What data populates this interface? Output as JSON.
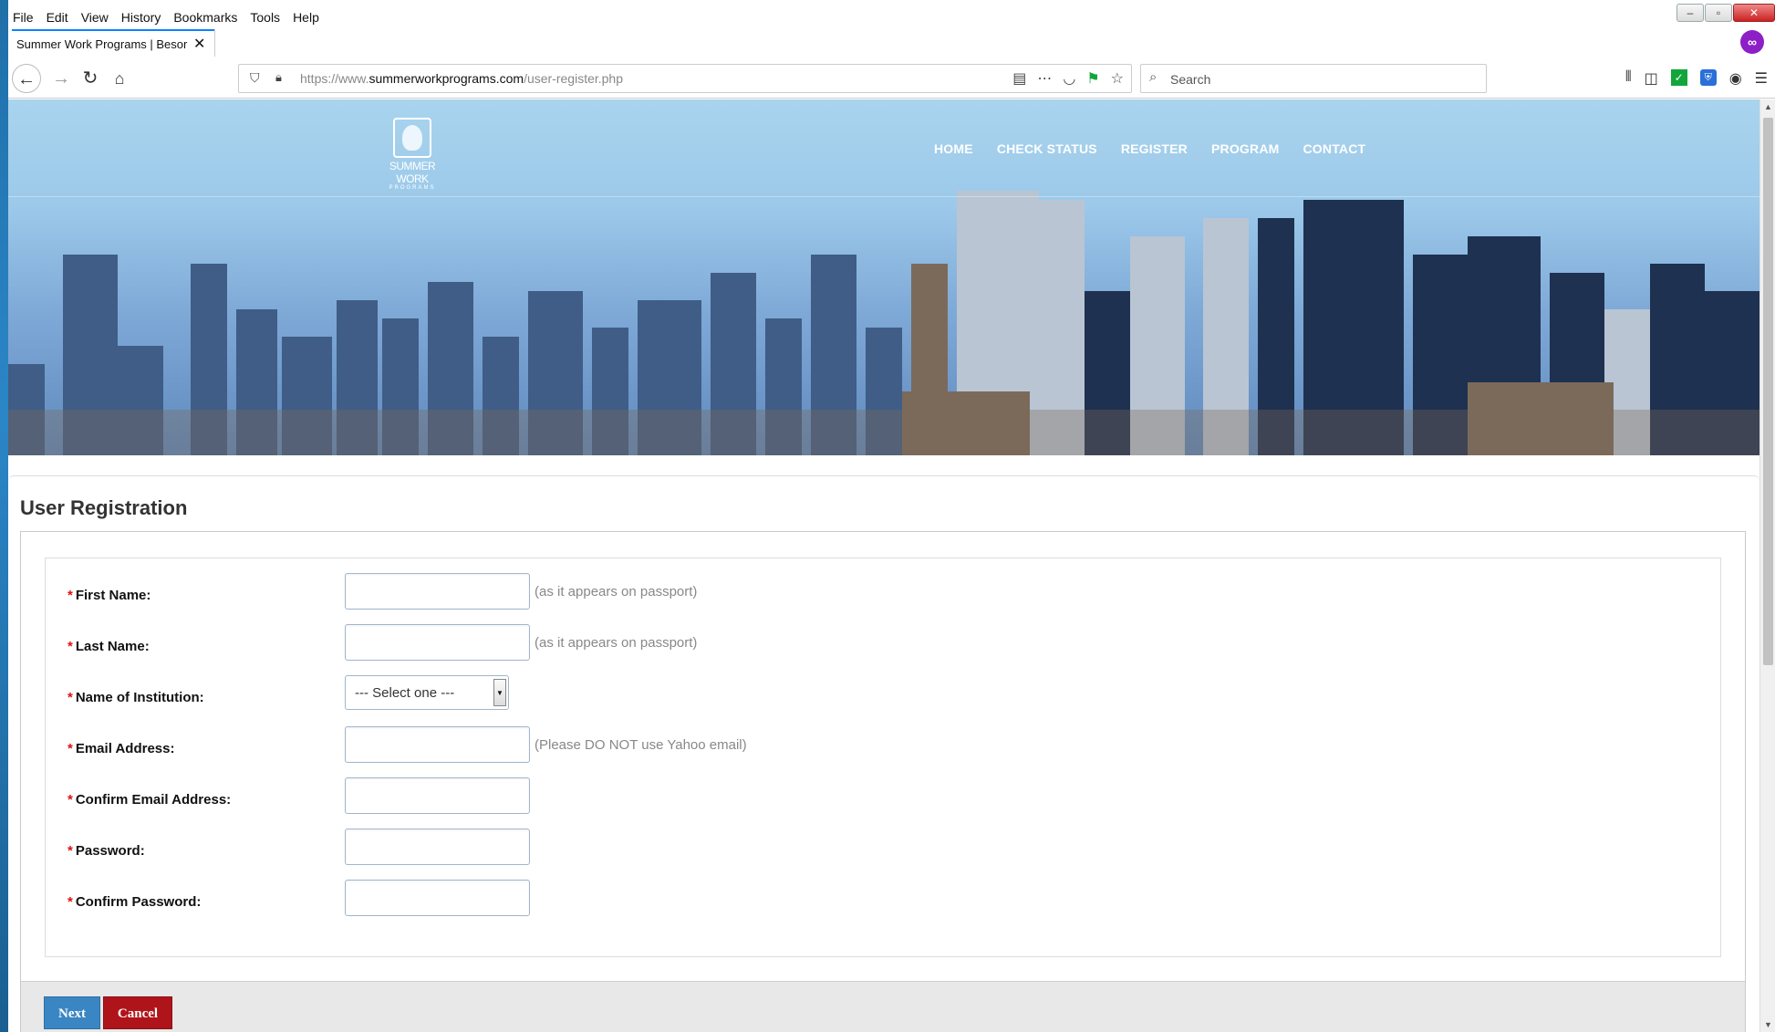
{
  "browser": {
    "menu": [
      "File",
      "Edit",
      "View",
      "History",
      "Bookmarks",
      "Tools",
      "Help"
    ],
    "menu_accel": [
      "F",
      "E",
      "V",
      "s",
      "B",
      "T",
      "H"
    ],
    "tab_title": "Summer Work Programs | Besor As",
    "url_prefix": "https://www.",
    "url_domain": "summerworkprograms.com",
    "url_path": "/user-register.php",
    "search_placeholder": "Search"
  },
  "site": {
    "logo_text": "SUMMER WORK",
    "logo_sub": "PROGRAMS",
    "nav": [
      "HOME",
      "CHECK STATUS",
      "REGISTER",
      "PROGRAM",
      "CONTACT"
    ]
  },
  "form": {
    "title": "User Registration",
    "required_mark": "*",
    "fields": [
      {
        "label": "First Name:",
        "hint": "(as it appears on passport)"
      },
      {
        "label": "Last Name:",
        "hint": "(as it appears on passport)"
      },
      {
        "label": "Name of Institution:",
        "select_value": "--- Select one ---"
      },
      {
        "label": "Email Address:",
        "hint": "(Please DO NOT use Yahoo email)"
      },
      {
        "label": "Confirm Email Address:"
      },
      {
        "label": "Password:"
      },
      {
        "label": "Confirm Password:"
      }
    ],
    "next_label": "Next",
    "cancel_label": "Cancel"
  },
  "colors": {
    "required": "#dd1111",
    "next_button": "#3a86c4",
    "cancel_button": "#b0141b",
    "tab_accent": "#0a84ff"
  }
}
